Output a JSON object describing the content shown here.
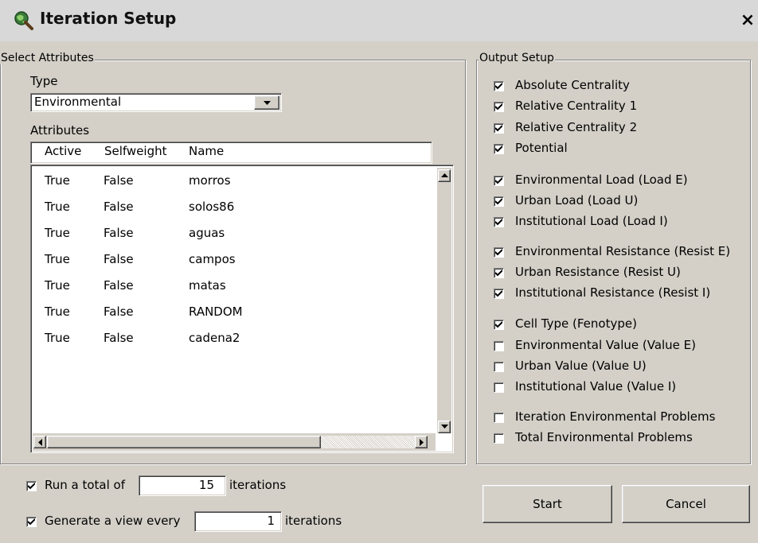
{
  "window": {
    "title": "Iteration Setup",
    "close": "×"
  },
  "select_attributes": {
    "group_label": "Select Attributes",
    "type_label": "Type",
    "type_value": "Environmental",
    "attributes_label": "Attributes",
    "columns": [
      "Active",
      "Selfweight",
      "Name"
    ],
    "rows": [
      {
        "active": "True",
        "selfweight": "False",
        "name": "morros"
      },
      {
        "active": "True",
        "selfweight": "False",
        "name": "solos86"
      },
      {
        "active": "True",
        "selfweight": "False",
        "name": "aguas"
      },
      {
        "active": "True",
        "selfweight": "False",
        "name": "campos"
      },
      {
        "active": "True",
        "selfweight": "False",
        "name": "matas"
      },
      {
        "active": "True",
        "selfweight": "False",
        "name": "RANDOM"
      },
      {
        "active": "True",
        "selfweight": "False",
        "name": "cadena2"
      }
    ]
  },
  "output_setup": {
    "group_label": "Output Setup",
    "options": [
      {
        "label": "Absolute Centrality",
        "checked": true
      },
      {
        "label": "Relative Centrality 1",
        "checked": true
      },
      {
        "label": "Relative Centrality 2",
        "checked": true
      },
      {
        "label": "Potential",
        "checked": true
      },
      {
        "label": "Environmental Load (Load E)",
        "checked": true
      },
      {
        "label": "Urban Load (Load U)",
        "checked": true
      },
      {
        "label": "Institutional Load (Load I)",
        "checked": true
      },
      {
        "label": "Environmental Resistance (Resist E)",
        "checked": true
      },
      {
        "label": "Urban Resistance (Resist U)",
        "checked": true
      },
      {
        "label": "Institutional Resistance (Resist I)",
        "checked": true
      },
      {
        "label": "Cell Type (Fenotype)",
        "checked": true
      },
      {
        "label": "Environmental Value (Value E)",
        "checked": false
      },
      {
        "label": "Urban Value (Value U)",
        "checked": false
      },
      {
        "label": "Institutional Value (Value I)",
        "checked": false
      },
      {
        "label": "Iteration Environmental Problems",
        "checked": false
      },
      {
        "label": "Total Environmental Problems",
        "checked": false
      }
    ]
  },
  "run": {
    "total_label": "Run a total of",
    "total_value": "15",
    "total_suffix": "iterations",
    "total_checked": true,
    "view_label": "Generate a view every",
    "view_value": "1",
    "view_suffix": "iterations",
    "view_checked": true
  },
  "buttons": {
    "start": "Start",
    "cancel": "Cancel"
  }
}
